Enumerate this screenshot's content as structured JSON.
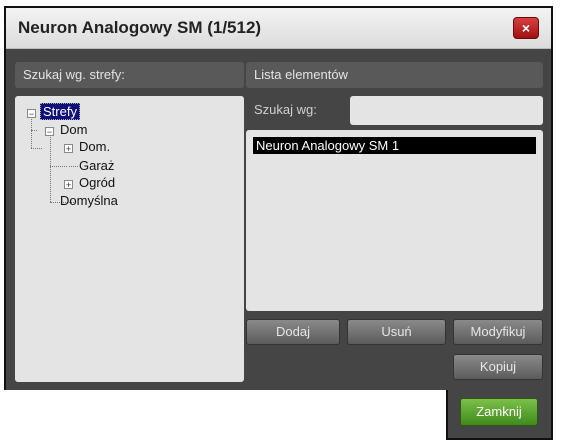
{
  "window": {
    "title": "Neuron Analogowy SM (1/512)",
    "close_label": "×"
  },
  "left": {
    "header": "Szukaj wg. strefy:",
    "tree": {
      "root": "Strefy",
      "dom": "Dom",
      "dom_child": "Dom.",
      "garaz": "Garaż",
      "ogrod": "Ogród",
      "domyslna": "Domyślna"
    }
  },
  "right": {
    "header": "Lista elementów",
    "search_label": "Szukaj wg:",
    "search_value": "",
    "items": [
      "Neuron Analogowy SM 1"
    ]
  },
  "buttons": {
    "add": "Dodaj",
    "remove": "Usuń",
    "modify": "Modyfikuj",
    "copy": "Kopiuj",
    "close": "Zamknij"
  }
}
